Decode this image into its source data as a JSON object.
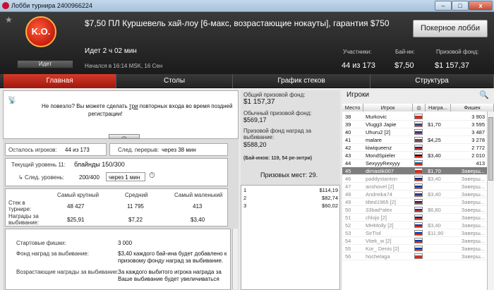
{
  "window": {
    "title": "Лобби турнира 2400966224",
    "min": "–",
    "max": "□",
    "close": "x"
  },
  "header": {
    "logo_text": "K.O.",
    "status": "Идет",
    "name": "$7,50 ПЛ Куршевель хай-лоу [6-макс, возрастающие нокауты], гарантия $750",
    "lobby_button": "Покерное лобби",
    "elapsed": "Идет 2 ч 02 мин",
    "started": "Начался в 16:14 MSK, 16 Сен",
    "participants_label": "Участники:",
    "participants_value": "44 из 173",
    "buyin_label": "Бай-ин:",
    "buyin_value": "$7,50",
    "prize_label": "Призовой фонд:",
    "prize_value": "$1 157,37"
  },
  "tabs": [
    {
      "label": "Главная"
    },
    {
      "label": "Столы"
    },
    {
      "label": "График стеков"
    },
    {
      "label": "Структура"
    }
  ],
  "main": {
    "notice_pre": "Не повезло? Вы можете сделать ",
    "notice_link": "три",
    "notice_post": " повторных входа во время поздней",
    "notice_line2": "регистрации!",
    "players_left_label": "Осталось игроков:",
    "players_left_value": "44 из 173",
    "break_label": "След. перерыв:",
    "break_value": "через 38 мин",
    "level_label": "Текущий уровень 11:",
    "level_value": "блайнды 150/300",
    "next_label": "След. уровень:",
    "next_value": "200/400",
    "next_time": "через 1 мин",
    "stats_cols": [
      "Самый крупный",
      "Средний",
      "Самый маленький"
    ],
    "stack_label_1": "Стек в",
    "stack_label_2": "турнире:",
    "stack_values": [
      "48 427",
      "11 795",
      "413"
    ],
    "bounty_label_1": "Награды за",
    "bounty_label_2": "выбивание:",
    "bounty_values": [
      "$25,91",
      "$7,22",
      "$3,40"
    ],
    "starting_chips_label": "Стартовые фишки:",
    "starting_chips_value": "3 000",
    "bounty_fund_label": "Фонд наград за выбивание:",
    "bounty_fund_1": "$3,40 каждого бай-ина будет добавлено к",
    "bounty_fund_2": "призовому фонду наград за выбивание.",
    "increasing_label": "Возрастающие награды за выбивание:",
    "increasing_1": "За каждого выбитого игрока награда за",
    "increasing_2": "Ваше выбивание будет увеличиваться"
  },
  "prizes": {
    "total_label": "Общий призовой фонд:",
    "total_value": "$1 157,37",
    "regular_label": "Обычный призовой фонд:",
    "regular_value": "$569,17",
    "bounty_label_1": "Призовой фонд наград за",
    "bounty_label_2": "выбивание:",
    "bounty_value": "$588,20",
    "entries": "(Бай-инов: 119, 54 ре-энтри)",
    "places": "Призовых мест: 29.",
    "places_list": [
      {
        "place": "1",
        "prize": "$114,19"
      },
      {
        "place": "2",
        "prize": "$82,74"
      },
      {
        "place": "3",
        "prize": "$60,02"
      }
    ]
  },
  "players": {
    "title": "Игроки",
    "cols": [
      "Место",
      "Игрок",
      "",
      "Награ...",
      "Фишек"
    ],
    "rows": [
      {
        "place": "38",
        "name": "Murkovic",
        "bounty": "",
        "chips": "3 903",
        "flag": "#d52b1e",
        "state": "active"
      },
      {
        "place": "39",
        "name": "Vlugg3 Japie",
        "bounty": "$1,70",
        "chips": "3 595",
        "flag": "#21468b",
        "state": "active"
      },
      {
        "place": "40",
        "name": "Uhuru2 [2]",
        "bounty": "",
        "chips": "3 487",
        "flag": "#0039a6",
        "state": "active"
      },
      {
        "place": "41",
        "name": "malare",
        "bounty": "$4,25",
        "chips": "3 278",
        "flag": "#006aa7",
        "state": "active"
      },
      {
        "place": "42",
        "name": "kiwiqueenz",
        "bounty": "",
        "chips": "2 772",
        "flag": "#00247d",
        "state": "active"
      },
      {
        "place": "43",
        "name": "MondSpieler",
        "bounty": "$3,40",
        "chips": "2 010",
        "flag": "#000000",
        "state": "active"
      },
      {
        "place": "44",
        "name": "SexyyyRexyyy",
        "bounty": "",
        "chips": "413",
        "flag": "#0d5eaf",
        "state": "active"
      },
      {
        "place": "45",
        "name": "dimastik007",
        "bounty": "$1,70",
        "chips": "Заверш...",
        "flag": "#d52b1e",
        "state": "selected"
      },
      {
        "place": "46",
        "name": "paddystanton",
        "bounty": "$3,40",
        "chips": "Заверш...",
        "flag": "#00247d",
        "state": "finished"
      },
      {
        "place": "47",
        "name": "anshovel [2]",
        "bounty": "",
        "chips": "Заверш...",
        "flag": "#0039a6",
        "state": "finished"
      },
      {
        "place": "48",
        "name": "Andreika74",
        "bounty": "$3,40",
        "chips": "Заверш...",
        "flag": "#0039a6",
        "state": "finished"
      },
      {
        "place": "49",
        "name": "tilted1965 [2]",
        "bounty": "",
        "chips": "Заверш...",
        "flag": "#00247d",
        "state": "finished"
      },
      {
        "place": "50",
        "name": "33bad*alex",
        "bounty": "$6,80",
        "chips": "Заверш...",
        "flag": "#0039a6",
        "state": "finished"
      },
      {
        "place": "51",
        "name": "chlojo [2]",
        "bounty": "",
        "chips": "Заверш...",
        "flag": "#00247d",
        "state": "finished"
      },
      {
        "place": "52",
        "name": "MHMolly [2]",
        "bounty": "$3,40",
        "chips": "Заверш...",
        "flag": "#0039a6",
        "state": "finished"
      },
      {
        "place": "53",
        "name": "SirTIol",
        "bounty": "$11,90",
        "chips": "Заверш...",
        "flag": "#0039a6",
        "state": "finished"
      },
      {
        "place": "54",
        "name": "Vitek_w [2]",
        "bounty": "",
        "chips": "Заверш...",
        "flag": "#0039a6",
        "state": "finished"
      },
      {
        "place": "55",
        "name": "Kor_ Denis [2]",
        "bounty": "",
        "chips": "Заверш...",
        "flag": "#0039a6",
        "state": "finished"
      },
      {
        "place": "56",
        "name": "hochelaga",
        "bounty": "",
        "chips": "Заверш...",
        "flag": "#d52b1e",
        "state": "finished"
      }
    ]
  },
  "colors": {
    "accent": "#c0281a",
    "header_bg": "#262626",
    "selected_row": "#7e7e7e"
  }
}
